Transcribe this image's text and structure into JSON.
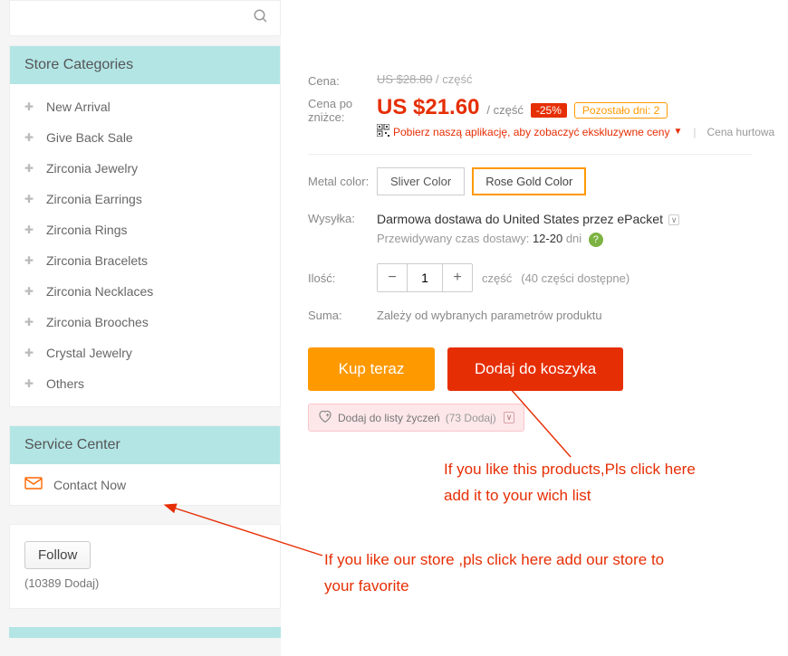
{
  "sidebar": {
    "categories_header": "Store Categories",
    "categories": [
      "New Arrival",
      "Give Back Sale",
      "Zirconia Jewelry",
      "Zirconia Earrings",
      "Zirconia Rings",
      "Zirconia Bracelets",
      "Zirconia Necklaces",
      "Zirconia Brooches",
      "Crystal Jewelry",
      "Others"
    ],
    "service_header": "Service Center",
    "contact_label": "Contact Now",
    "follow_label": "Follow",
    "follow_count": "(10389 Dodaj)"
  },
  "product": {
    "price_label": "Cena:",
    "discounted_label_1": "Cena po",
    "discounted_label_2": "zniżce:",
    "old_price": "US $28.80",
    "old_price_unit": " / część",
    "new_price": "US $21.60",
    "price_unit": "/ część",
    "discount_badge": "-25%",
    "days_left": "Pozostało dni: 2",
    "app_promo": "Pobierz naszą aplikację, aby zobaczyć ekskluzywne ceny",
    "wholesale_label": "Cena hurtowa",
    "metal_color_label": "Metal color:",
    "variants": [
      "Sliver Color",
      "Rose Gold Color"
    ],
    "shipping_label": "Wysyłka:",
    "shipping_prefix": "Darmowa dostawa do ",
    "shipping_dest": "United States",
    "shipping_via": " przez ",
    "shipping_method": "ePacket",
    "eta_prefix": "Przewidywany czas dostawy: ",
    "eta_days": "12-20",
    "eta_unit": " dni",
    "qty_label": "Ilość:",
    "qty_value": "1",
    "qty_unit": "część",
    "qty_available": "(40 części dostępne)",
    "total_label": "Suma:",
    "total_text": "Zależy od wybranych parametrów produktu",
    "buy_now": "Kup teraz",
    "add_to_cart": "Dodaj do koszyka",
    "wishlist_label": "Dodaj do listy życzeń",
    "wishlist_count": "(73 Dodaj)"
  },
  "annotations": {
    "wishlist_note": "If you like this products,Pls click here add it to your wich list",
    "follow_note": "If you like our store ,pls click here add our store to your favorite"
  }
}
